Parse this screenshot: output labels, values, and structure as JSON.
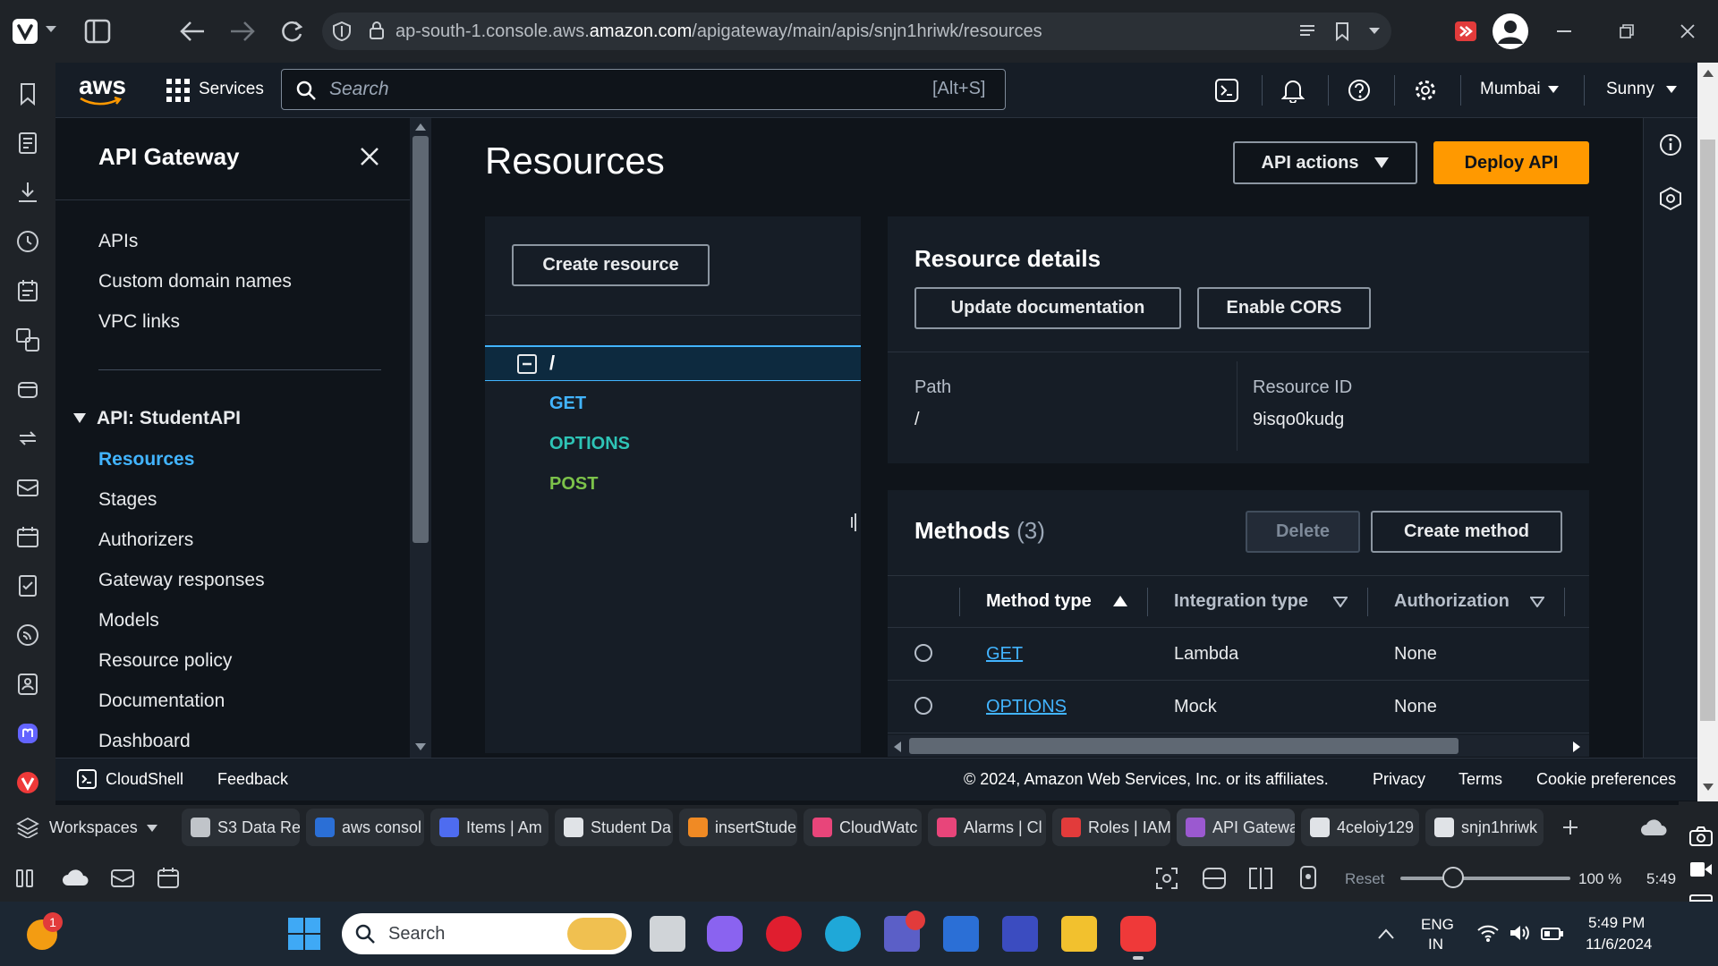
{
  "browser": {
    "url_prefix": "ap-south-1.console.aws.",
    "url_domain": "amazon.com",
    "url_path": "/apigateway/main/apis/snjn1hriwk/resources"
  },
  "aws_header": {
    "logo": "aws",
    "services_label": "Services",
    "search_placeholder": "Search",
    "search_shortcut": "[Alt+S]",
    "region": "Mumbai",
    "user": "Sunny"
  },
  "sidebar": {
    "title": "API Gateway",
    "top_items": [
      "APIs",
      "Custom domain names",
      "VPC links"
    ],
    "api_section_label": "API: StudentAPI",
    "api_items": [
      "Resources",
      "Stages",
      "Authorizers",
      "Gateway responses",
      "Models",
      "Resource policy",
      "Documentation",
      "Dashboard"
    ],
    "active_item": "Resources"
  },
  "main": {
    "page_title": "Resources",
    "api_actions_label": "API actions",
    "deploy_label": "Deploy API",
    "create_resource_label": "Create resource",
    "tree": {
      "root": "/",
      "methods": [
        {
          "name": "GET",
          "color": "#42b4ff"
        },
        {
          "name": "OPTIONS",
          "color": "#2ec4b6"
        },
        {
          "name": "POST",
          "color": "#7cc24a"
        }
      ]
    },
    "details": {
      "title": "Resource details",
      "update_doc_label": "Update documentation",
      "enable_cors_label": "Enable CORS",
      "path_label": "Path",
      "path_value": "/",
      "resource_id_label": "Resource ID",
      "resource_id_value": "9isqo0kudg"
    },
    "methods": {
      "title": "Methods",
      "count": "(3)",
      "delete_label": "Delete",
      "create_label": "Create method",
      "columns": [
        "Method type",
        "Integration type",
        "Authorization"
      ],
      "rows": [
        {
          "method": "GET",
          "integration": "Lambda",
          "auth": "None"
        },
        {
          "method": "OPTIONS",
          "integration": "Mock",
          "auth": "None"
        }
      ]
    }
  },
  "footer": {
    "cloudshell": "CloudShell",
    "feedback": "Feedback",
    "copyright": "© 2024, Amazon Web Services, Inc. or its affiliates.",
    "privacy": "Privacy",
    "terms": "Terms",
    "cookies": "Cookie preferences"
  },
  "tabs": {
    "workspaces_label": "Workspaces",
    "items": [
      {
        "label": "S3 Data Re",
        "color": "#c0c4c9"
      },
      {
        "label": "aws consol",
        "color": "#2b6fd6"
      },
      {
        "label": "Items | Am",
        "color": "#4e6cf0"
      },
      {
        "label": "Student Da",
        "color": "#e0e3e7"
      },
      {
        "label": "insertStude",
        "color": "#f08a24"
      },
      {
        "label": "CloudWatc",
        "color": "#e8457a"
      },
      {
        "label": "Alarms | Cl",
        "color": "#e8457a"
      },
      {
        "label": "Roles | IAM",
        "color": "#e23b3b"
      },
      {
        "label": "API Gatewa",
        "color": "#9b59d0"
      },
      {
        "label": "4celoiy129",
        "color": "#e0e3e7"
      },
      {
        "label": "snjn1hriwk",
        "color": "#e0e3e7"
      }
    ]
  },
  "status": {
    "reset_label": "Reset",
    "zoom_level": 100,
    "zoom": "100 %",
    "time_short": "5:49 I"
  },
  "taskbar": {
    "search_placeholder": "Search",
    "weather_badge": "1",
    "lang": "ENG",
    "region": "IN",
    "time": "5:49 PM",
    "date": "11/6/2024"
  }
}
